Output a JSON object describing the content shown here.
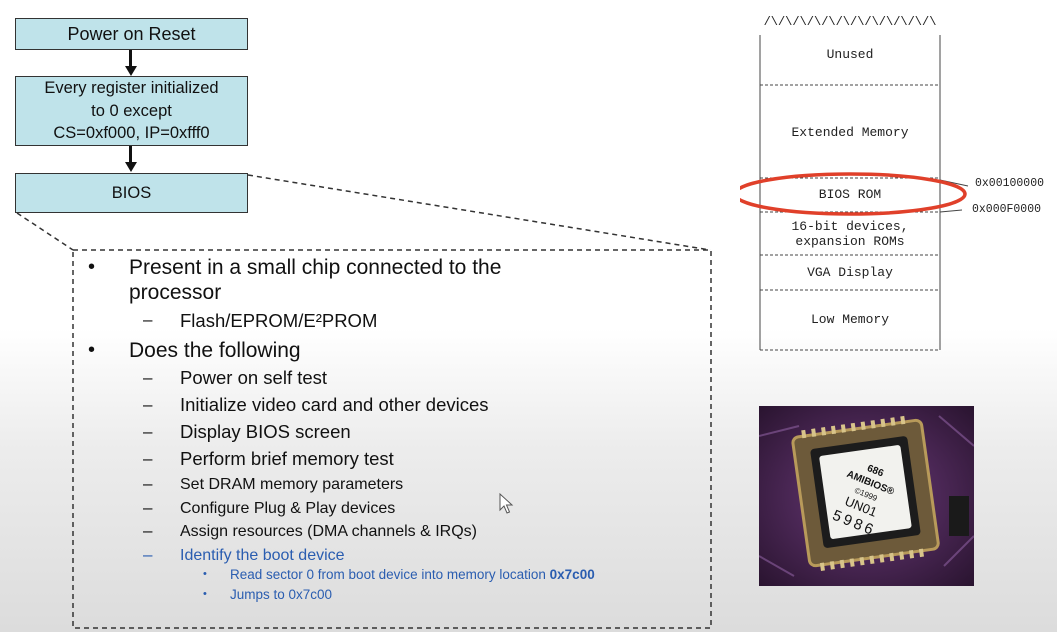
{
  "flow": {
    "box1": "Power on Reset",
    "box2_line1": "Every register initialized",
    "box2_line2": "to 0 except",
    "box2_line3": "CS=0xf000, IP=0xfff0",
    "box3": "BIOS"
  },
  "detail": {
    "bullet1_line1": "Present in a small chip connected to the",
    "bullet1_line2": "processor",
    "bullet1_sub1": "Flash/EPROM/E²PROM",
    "bullet2": "Does the following",
    "items": [
      "Power on self test",
      "Initialize video card and other devices",
      "Display BIOS screen",
      "Perform brief memory test",
      "Set DRAM memory parameters",
      "Configure Plug & Play devices",
      "Assign resources (DMA channels & IRQs)",
      "Identify the boot device"
    ],
    "subitem1_text": "Read sector 0 from boot device into memory location ",
    "subitem1_bold": "0x7c00",
    "subitem2": "Jumps to 0x7c00",
    "bullet_glyph": "•",
    "dash_glyph": "–"
  },
  "memory_map": {
    "top_pattern": "/\\/\\/\\/\\/\\/\\/\\/\\/\\/\\/\\/\\",
    "regions": [
      "Unused",
      "Extended Memory",
      "BIOS ROM",
      "16-bit devices,",
      "expansion ROMs",
      "VGA Display",
      "Low Memory"
    ],
    "addr_upper": "0x00100000",
    "addr_lower": "0x000F0000",
    "highlight_color": "#e0402a"
  },
  "chip_label": [
    "686",
    "AMIBIOS®",
    "©1999",
    "UN01",
    "5986"
  ],
  "colors": {
    "box_fill": "#bfe3ea",
    "link_blue": "#2a5db0"
  },
  "icons": {
    "cursor": "mouse-pointer-icon",
    "chip": "bios-chip-photo"
  }
}
